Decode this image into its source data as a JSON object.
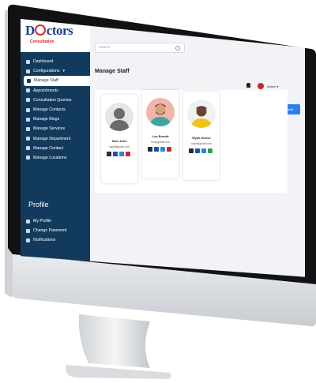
{
  "brand": {
    "name_part1": "D",
    "name_part2": "ctors",
    "tagline": "Consultation"
  },
  "sidebar": {
    "items": [
      {
        "label": "Dashboard",
        "icon": "grid-icon"
      },
      {
        "label": "Configurations",
        "icon": "sliders-icon",
        "has_caret": true
      },
      {
        "label": "Manage Staff",
        "icon": "users-icon",
        "active": true
      },
      {
        "label": "Appointments",
        "icon": "calendar-icon"
      },
      {
        "label": "Consultation Queries",
        "icon": "chat-icon"
      },
      {
        "label": "Manage Contacts",
        "icon": "contact-icon"
      },
      {
        "label": "Manage Blogs",
        "icon": "blog-icon"
      },
      {
        "label": "Manage Services",
        "icon": "services-icon"
      },
      {
        "label": "Manage Department",
        "icon": "building-icon"
      },
      {
        "label": "Manage Contact",
        "icon": "phone-icon"
      },
      {
        "label": "Manage Locations",
        "icon": "location-icon"
      }
    ],
    "profile_heading": "Profile",
    "profile_items": [
      {
        "label": "My Profile",
        "icon": "user-icon"
      },
      {
        "label": "Change Password",
        "icon": "lock-icon"
      },
      {
        "label": "Notifications",
        "icon": "bell-icon"
      }
    ]
  },
  "header": {
    "search_placeholder": "Search",
    "admin_label": "Admin"
  },
  "page": {
    "title": "Manage Staff",
    "add_button": "Add New Staff"
  },
  "staff": [
    {
      "name": "Sam John",
      "email": "sam@gmail.com",
      "avatar": "placeholder"
    },
    {
      "name": "Leo Brandt",
      "email": "leo@gmail.com",
      "avatar": "man-beard"
    },
    {
      "name": "Ryan Kiruve",
      "email": "ryan@gmail.com",
      "avatar": "man-yellow"
    }
  ],
  "colors": {
    "sidebar": "#123a5c",
    "accent": "#2f80ed",
    "brand": "#1b3f8f",
    "danger": "#c62828"
  }
}
